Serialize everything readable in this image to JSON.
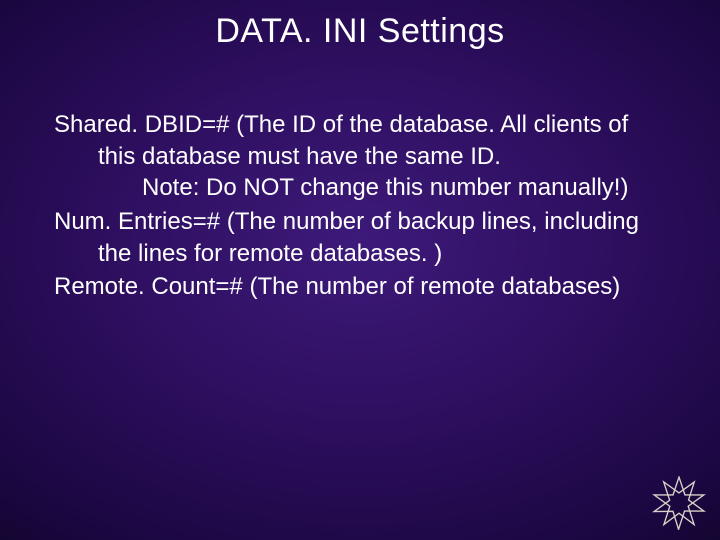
{
  "title": "DATA. INI Settings",
  "entries": {
    "e1": {
      "line1": "Shared. DBID=# (The ID of the database.  All clients of this database must have the same ID.",
      "note": "Note: Do NOT change this number manually!)"
    },
    "e2": {
      "line1": "Num. Entries=# (The number of backup lines, including the lines for remote databases. )"
    },
    "e3": {
      "line1": "Remote. Count=# (The number of remote databases)"
    }
  }
}
